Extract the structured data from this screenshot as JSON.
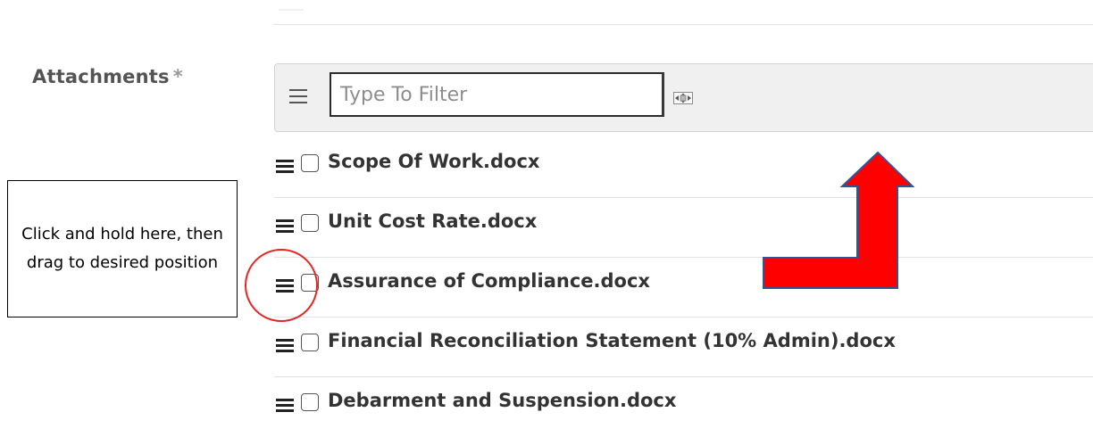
{
  "form": {
    "attachments_label": "Attachments",
    "required_marker": "*"
  },
  "toolbar": {
    "menu_icon": "hamburger-icon",
    "filter_placeholder": "Type To Filter",
    "filter_value": "",
    "expand_icon": "expand-icon"
  },
  "attachments": [
    {
      "name": "Scope Of Work.docx",
      "checked": false
    },
    {
      "name": "Unit Cost Rate.docx",
      "checked": false
    },
    {
      "name": "Assurance of Compliance.docx",
      "checked": false
    },
    {
      "name": "Financial Reconciliation Statement (10% Admin).docx",
      "checked": false
    },
    {
      "name": "Debarment and Suspension.docx",
      "checked": false
    }
  ],
  "annotation": {
    "callout_text": "Click and hold here, then drag to desired position",
    "arrow_color": "#ff0000",
    "arrow_outline_color": "#2f5597",
    "ring_color": "#e32626"
  }
}
